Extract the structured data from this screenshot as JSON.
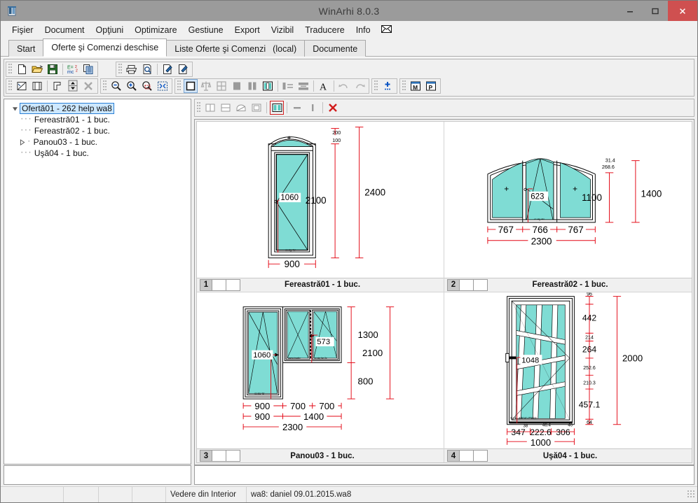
{
  "window": {
    "title": "WinArhi 8.0.3",
    "icon": "app-icon",
    "minimize": "minimize-icon",
    "maximize": "maximize-icon",
    "close": "close-icon",
    "accent_close": "#cf5050",
    "titlebar_bg": "#9b9b9b"
  },
  "menu": {
    "items": [
      {
        "label": "Fişier"
      },
      {
        "label": "Document"
      },
      {
        "label": "Opţiuni"
      },
      {
        "label": "Optimizare"
      },
      {
        "label": "Gestiune"
      },
      {
        "label": "Export"
      },
      {
        "label": "Vizibil"
      },
      {
        "label": "Traducere"
      },
      {
        "label": "Info"
      },
      {
        "label": "✉",
        "name": "mail-icon"
      }
    ]
  },
  "tabs": [
    {
      "label": "Start",
      "active": false
    },
    {
      "label": "Oferte şi Comenzi deschise",
      "active": true
    },
    {
      "label": "Liste Oferte şi Comenzi",
      "sub": "(local)",
      "active": false
    },
    {
      "label": "Documente",
      "active": false
    }
  ],
  "toolbar": {
    "row1": [
      {
        "name": "new-document-icon",
        "title": "Nou"
      },
      {
        "name": "open-folder-icon",
        "title": "Deschide"
      },
      {
        "name": "save-disk-icon",
        "title": "Salvează"
      },
      {
        "name": "formula-icon",
        "title": "E=mc2"
      },
      {
        "name": "copy-icon",
        "title": "Copiază"
      },
      {
        "name": "print-icon",
        "title": "Tipăreşte"
      },
      {
        "name": "print-preview-icon",
        "title": "Previzualizare"
      },
      {
        "name": "edit-document-icon",
        "title": "Editează"
      },
      {
        "name": "edit-document2-icon",
        "title": "Editează 2"
      }
    ],
    "row2": [
      {
        "name": "measure-icon"
      },
      {
        "name": "duplicate-icon"
      },
      {
        "name": "corner-icon"
      },
      {
        "name": "spinner-icon"
      },
      {
        "name": "delete-x-icon"
      },
      {
        "name": "zoom-out-icon"
      },
      {
        "name": "zoom-in-icon"
      },
      {
        "name": "zoom-region-icon"
      },
      {
        "name": "zoom-fit-icon"
      },
      {
        "name": "single-view-icon",
        "selected": true
      },
      {
        "name": "mirror-icon"
      },
      {
        "name": "grid-icon"
      },
      {
        "name": "fill-solid-icon"
      },
      {
        "name": "two-pane-icon"
      },
      {
        "name": "three-pane-icon"
      },
      {
        "name": "align-left-icon"
      },
      {
        "name": "align-center-icon"
      },
      {
        "name": "text-icon"
      },
      {
        "name": "undo-icon"
      },
      {
        "name": "redo-icon"
      },
      {
        "name": "points-icon"
      },
      {
        "name": "m-window-icon"
      },
      {
        "name": "p-window-icon"
      }
    ],
    "subrow": [
      {
        "name": "split-vertical-icon"
      },
      {
        "name": "split-horizontal-icon"
      },
      {
        "name": "arch-icon"
      },
      {
        "name": "frame-icon"
      },
      {
        "name": "two-sash-icon",
        "selected_red": true
      },
      {
        "name": "horizontal-bar-icon"
      },
      {
        "name": "vertical-bar-icon"
      },
      {
        "name": "delete-red-x-icon"
      }
    ]
  },
  "tree": {
    "root": {
      "label": "Ofertă01 - 262 help wa8",
      "selected": true,
      "expander": "expanded"
    },
    "children": [
      {
        "label": "Fereastră01 - 1 buc.",
        "expander": "none"
      },
      {
        "label": "Fereastră02 - 1 buc.",
        "expander": "none"
      },
      {
        "label": "Panou03 - 1 buc.",
        "expander": "collapsed"
      },
      {
        "label": "Uşă04 - 1 buc.",
        "expander": "none"
      }
    ]
  },
  "drawings": [
    {
      "index": "1",
      "name": "Fereastră01 - 1 buc.",
      "dims": {
        "width": "900",
        "heights": [
          "2100",
          "2400"
        ],
        "top_small": [
          "200",
          "100"
        ],
        "opening": "1060",
        "glass_note": "cc alg 4sr"
      }
    },
    {
      "index": "2",
      "name": "Fereastră02 - 1 buc.",
      "dims": {
        "widths": [
          "767",
          "766",
          "767"
        ],
        "total_width": "2300",
        "heights": [
          "1100",
          "1400"
        ],
        "top_small": [
          "31.4",
          "268.6"
        ],
        "opening": "623",
        "glass_note": "cc alg 4sr"
      }
    },
    {
      "index": "3",
      "name": "Panou03 - 1 buc.",
      "dims": {
        "widths_row1": [
          "900",
          "700",
          "700"
        ],
        "widths_row2": [
          "900",
          "1400"
        ],
        "total_width": "2300",
        "heights": [
          "1300",
          "800"
        ],
        "total_height": "2100",
        "opening_left": "1060",
        "opening_right": "573",
        "notes": [
          "cama inactiv",
          "cc alg 4sr 2c",
          "cc alg 4sr"
        ]
      }
    },
    {
      "index": "4",
      "name": "Uşă04 - 1 buc.",
      "dims": {
        "widths": [
          "347",
          "222.6",
          "306"
        ],
        "total_width": "1000",
        "small_widths": [
          "38",
          "46.4",
          "40"
        ],
        "heights": [
          "96",
          "442",
          "214",
          "264",
          "252.6",
          "210.3",
          "457.1",
          "64"
        ],
        "total_height": "2000",
        "opening": "1048",
        "glass_note": "5 pct 28mm PS23"
      }
    }
  ],
  "statusbar": {
    "view_mode": "Vedere din Interior",
    "file_info": "wa8: daniel 09.01.2015.wa8"
  },
  "colors": {
    "glass": "#7fdcd4",
    "dimension_red": "#e30613",
    "frame_line": "#000000",
    "selection_blue": "#cde8ff"
  }
}
